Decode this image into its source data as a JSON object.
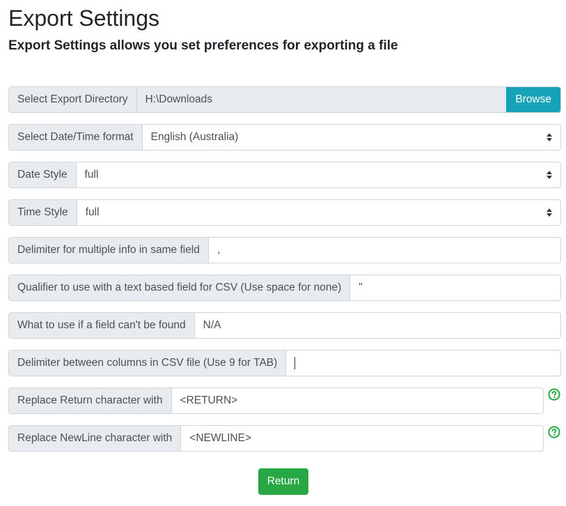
{
  "page": {
    "title": "Export Settings",
    "subtitle": "Export Settings allows you set preferences for exporting a file"
  },
  "rows": {
    "export_dir": {
      "label": "Select Export Directory",
      "value": "H:\\Downloads",
      "button": "Browse"
    },
    "datetime_format": {
      "label": "Select Date/Time format",
      "value": "English (Australia)"
    },
    "date_style": {
      "label": "Date Style",
      "value": "full"
    },
    "time_style": {
      "label": "Time Style",
      "value": "full"
    },
    "delimiter_multi": {
      "label": "Delimiter for multiple info in same field",
      "value": ","
    },
    "qualifier": {
      "label": "Qualifier to use with a text based field for CSV (Use space for none)",
      "value": "\""
    },
    "field_missing": {
      "label": "What to use if a field can't be found",
      "value": "N/A"
    },
    "delimiter_columns": {
      "label": "Delimiter between columns in CSV file (Use 9 for TAB)",
      "value": ""
    },
    "replace_return": {
      "label": "Replace Return character with",
      "value": "<RETURN>"
    },
    "replace_newline": {
      "label": "Replace NewLine character with",
      "value": "<NEWLINE>"
    }
  },
  "actions": {
    "return_label": "Return"
  },
  "icons": {
    "help": "question-circle-icon",
    "select": "select-arrows-icon"
  },
  "colors": {
    "info": "#17a2b8",
    "success": "#28a745",
    "addon_bg": "#e9ecef"
  }
}
